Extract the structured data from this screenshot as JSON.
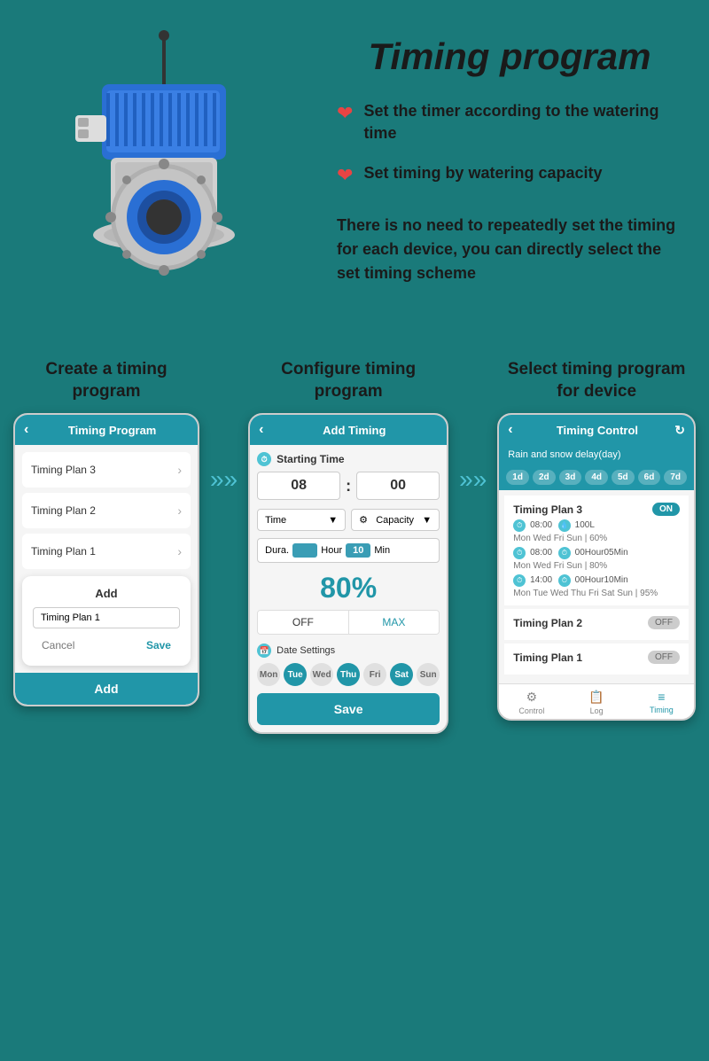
{
  "page": {
    "title": "Timing program",
    "bg_color": "#1a7a7a"
  },
  "top": {
    "features": [
      {
        "icon": "❤",
        "text": "Set the timer according to the watering time"
      },
      {
        "icon": "❤",
        "text": "Set timing by watering capacity"
      }
    ],
    "description": "There is no need to repeatedly set the timing for each device, you can directly select the set timing scheme"
  },
  "bottom": {
    "phone1": {
      "label": "Create a timing program",
      "header_title": "Timing Program",
      "list_items": [
        "Timing Plan 3",
        "Timing Plan 2",
        "Timing Plan 1"
      ],
      "dialog": {
        "add_label": "Add",
        "input_value": "Timing Plan 1",
        "cancel": "Cancel",
        "save": "Save"
      },
      "footer_add": "Add"
    },
    "phone2": {
      "label": "Configure timing program",
      "header_title": "Add Timing",
      "starting_time_label": "Starting Time",
      "hour": "08",
      "minute": "00",
      "time_label": "Time",
      "capacity_label": "Capacity",
      "dura_label": "Dura.",
      "hour_label": "Hour",
      "min_val": "10",
      "min_label": "Min",
      "percent": "80%",
      "off": "OFF",
      "max": "MAX",
      "date_settings": "Date Settings",
      "days": [
        {
          "label": "Mon",
          "active": false
        },
        {
          "label": "Tue",
          "active": true
        },
        {
          "label": "Wed",
          "active": false
        },
        {
          "label": "Thu",
          "active": true
        },
        {
          "label": "Fri",
          "active": false
        },
        {
          "label": "Sat",
          "active": true
        },
        {
          "label": "Sun",
          "active": false
        }
      ],
      "save": "Save"
    },
    "phone3": {
      "label": "Select timing program for device",
      "header_title": "Timing Control",
      "rain_snow_label": "Rain and snow delay(day)",
      "day_buttons": [
        "1d",
        "2d",
        "3d",
        "4d",
        "5d",
        "6d",
        "7d"
      ],
      "plans": [
        {
          "name": "Timing Plan 3",
          "toggle": "ON",
          "details": [
            {
              "time": "08:00",
              "extra": "100L",
              "days": "Mon Wed Fri Sun | 60%"
            },
            {
              "time": "08:00",
              "extra": "00Hour05Min",
              "days": "Mon Wed Fri Sun | 80%"
            },
            {
              "time": "14:00",
              "extra": "00Hour10Min",
              "days": "Mon Tue Wed Thu Fri Sat Sun | 95%"
            }
          ]
        },
        {
          "name": "Timing Plan 2",
          "toggle": "OFF"
        },
        {
          "name": "Timing Plan 1",
          "toggle": "OFF"
        }
      ],
      "nav_items": [
        {
          "label": "Control",
          "icon": "⚙",
          "active": false
        },
        {
          "label": "Log",
          "icon": "📋",
          "active": false
        },
        {
          "label": "Timing",
          "icon": "≡",
          "active": true
        }
      ]
    }
  }
}
